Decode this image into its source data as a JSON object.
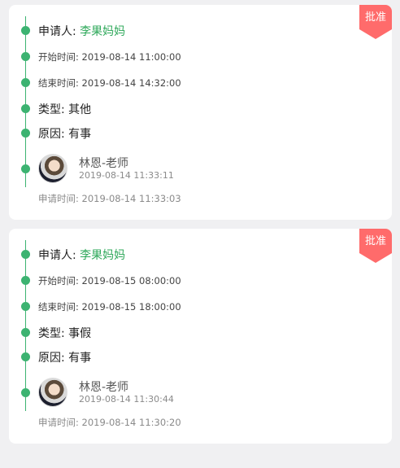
{
  "accent_green": "#3cb371",
  "badge_color": "#ff6b6b",
  "records": [
    {
      "status_badge": "批准",
      "applicant_label": "申请人:",
      "applicant_name": "李果妈妈",
      "start_label": "开始时间:",
      "start_time": "2019-08-14 11:00:00",
      "end_label": "结束时间:",
      "end_time": "2019-08-14 14:32:00",
      "type_label": "类型:",
      "type_value": "其他",
      "reason_label": "原因:",
      "reason_value": "有事",
      "approver_name": "林恩-老师",
      "approver_time": "2019-08-14 11:33:11",
      "apply_label": "申请时间:",
      "apply_time": "2019-08-14 11:33:03"
    },
    {
      "status_badge": "批准",
      "applicant_label": "申请人:",
      "applicant_name": "李果妈妈",
      "start_label": "开始时间:",
      "start_time": "2019-08-15 08:00:00",
      "end_label": "结束时间:",
      "end_time": "2019-08-15 18:00:00",
      "type_label": "类型:",
      "type_value": "事假",
      "reason_label": "原因:",
      "reason_value": "有事",
      "approver_name": "林恩-老师",
      "approver_time": "2019-08-14 11:30:44",
      "apply_label": "申请时间:",
      "apply_time": "2019-08-14 11:30:20"
    }
  ]
}
